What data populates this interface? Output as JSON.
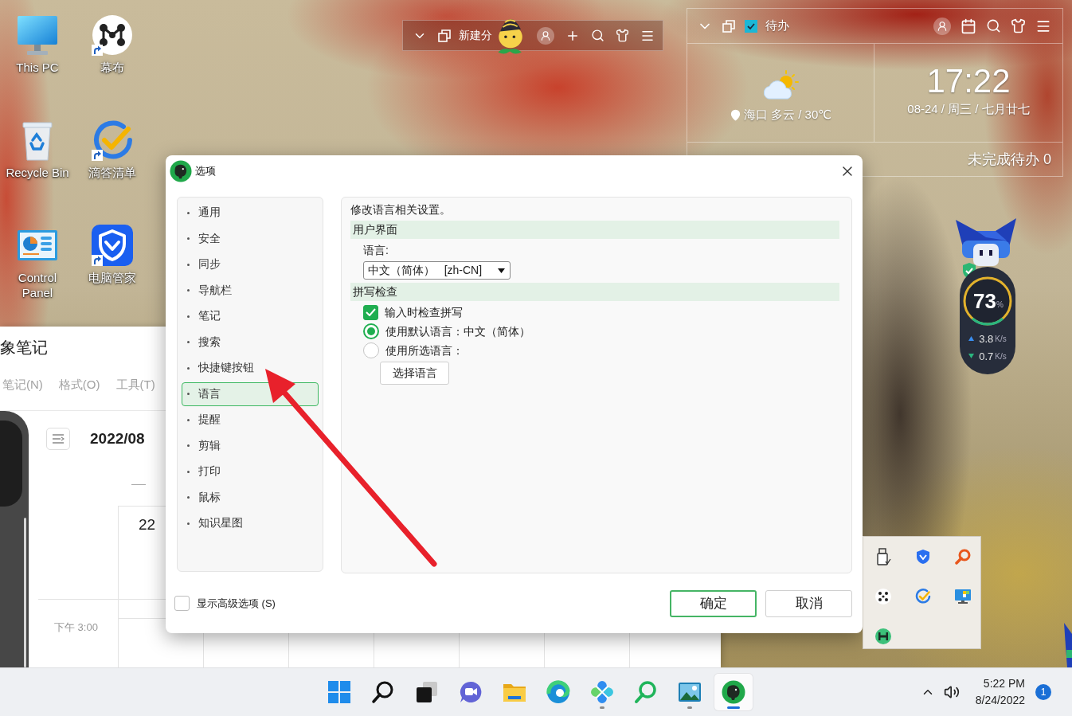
{
  "desktop_icons": [
    {
      "kind": "pc",
      "label": "This PC",
      "shortcut": false
    },
    {
      "kind": "mubu",
      "label": "幕布",
      "shortcut": true
    },
    {
      "kind": "recycle",
      "label": "Recycle Bin",
      "shortcut": false
    },
    {
      "kind": "dida",
      "label": "滴答清单",
      "shortcut": true
    },
    {
      "kind": "control",
      "label": "Control Panel",
      "shortcut": false
    },
    {
      "kind": "guard",
      "label": "电脑管家",
      "shortcut": true
    }
  ],
  "top_toolbar": {
    "new_label": "新建分"
  },
  "todo_widget": {
    "title": "待办",
    "weather": "海口 多云 / 30℃",
    "time": "17:22",
    "date": "08-24 / 周三 / 七月廿七",
    "pending": "未完成待办 0"
  },
  "speed_widget": {
    "percent": "73",
    "unit": "%",
    "rates": [
      {
        "kind": "up",
        "value": "3.8",
        "unit": "K/s"
      },
      {
        "kind": "down",
        "value": "0.7",
        "unit": "K/s"
      }
    ]
  },
  "background_window": {
    "title": "象笔记",
    "menu": [
      "笔记(N)",
      "格式(O)",
      "工具(T)"
    ],
    "month": "2022/08",
    "day": "22",
    "time_label": "下午 3:00"
  },
  "dialog": {
    "title": "选项",
    "nav": [
      {
        "label": "通用",
        "selected": false
      },
      {
        "label": "安全",
        "selected": false
      },
      {
        "label": "同步",
        "selected": false
      },
      {
        "label": "导航栏",
        "selected": false
      },
      {
        "label": "笔记",
        "selected": false
      },
      {
        "label": "搜索",
        "selected": false
      },
      {
        "label": "快捷键按钮",
        "selected": false
      },
      {
        "label": "语言",
        "selected": true
      },
      {
        "label": "提醒",
        "selected": false
      },
      {
        "label": "剪辑",
        "selected": false
      },
      {
        "label": "打印",
        "selected": false
      },
      {
        "label": "鼠标",
        "selected": false
      },
      {
        "label": "知识星图",
        "selected": false
      }
    ],
    "intro": "修改语言相关设置。",
    "sections": [
      {
        "heading": "用户界面",
        "rows": [
          {
            "kind": "label",
            "text": "语言:"
          },
          {
            "kind": "select",
            "value": "中文（简体）   [zh-CN]"
          }
        ]
      },
      {
        "heading": "拼写检查",
        "rows": [
          {
            "kind": "checkbox",
            "label": "输入时检查拼写",
            "checked": true
          },
          {
            "kind": "radio",
            "label": "使用默认语言：中文（简体）",
            "selected": true
          },
          {
            "kind": "radio",
            "label": "使用所选语言：",
            "selected": false
          },
          {
            "kind": "button",
            "label": "选择语言"
          }
        ]
      }
    ],
    "advanced": {
      "label": "显示高级选项 (S)",
      "checked": false
    },
    "buttons": [
      {
        "label": "确定",
        "default": true
      },
      {
        "label": "取消",
        "default": false
      }
    ]
  },
  "taskbar": {
    "apps": [
      {
        "kind": "start",
        "running": false,
        "active": false
      },
      {
        "kind": "search",
        "running": false,
        "active": false
      },
      {
        "kind": "taskview",
        "running": false,
        "active": false
      },
      {
        "kind": "chat",
        "running": false,
        "active": false
      },
      {
        "kind": "explorer",
        "running": false,
        "active": false
      },
      {
        "kind": "edge",
        "running": false,
        "active": false
      },
      {
        "kind": "petals",
        "running": true,
        "active": false
      },
      {
        "kind": "magnifier",
        "running": false,
        "active": false
      },
      {
        "kind": "photos",
        "running": true,
        "active": false
      },
      {
        "kind": "elephant",
        "running": true,
        "active": true
      }
    ],
    "time": "5:22 PM",
    "date": "8/24/2022",
    "notifications": "1"
  }
}
